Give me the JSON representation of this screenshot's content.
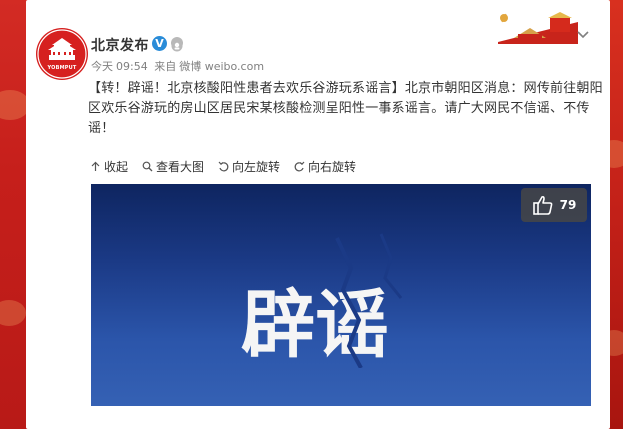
{
  "colors": {
    "page_red": "#c0211e",
    "link_orange": "#eb7350",
    "verify_blue": "#2a8cd8",
    "image_navy": "#1b3a86"
  },
  "account": {
    "name": "北京发布",
    "avatar_text": "YOBMPUT",
    "verified_icon": "verified-v-icon",
    "member_icon": "member-badge-icon"
  },
  "post_meta": {
    "date": "今天",
    "time": "09:54",
    "from": "来自",
    "source": "微博 weibo.com"
  },
  "post": {
    "prefix": "【转！辟谣！北京核酸阳性患者去欢乐谷游玩系谣言】",
    "body": "北京市朝阳区消息：网传前往朝阳区欢乐谷游玩的房山区居民宋某核酸检测呈阳性一事系谣言。请广大网民不信谣、不传谣！"
  },
  "media_toolbar": [
    {
      "icon": "collapse-up-icon",
      "label": "收起"
    },
    {
      "icon": "magnifier-icon",
      "label": "查看大图"
    },
    {
      "icon": "rotate-left-icon",
      "label": "向左旋转"
    },
    {
      "icon": "rotate-right-icon",
      "label": "向右旋转"
    }
  ],
  "image": {
    "headline": "辟谣",
    "likes": "79"
  }
}
